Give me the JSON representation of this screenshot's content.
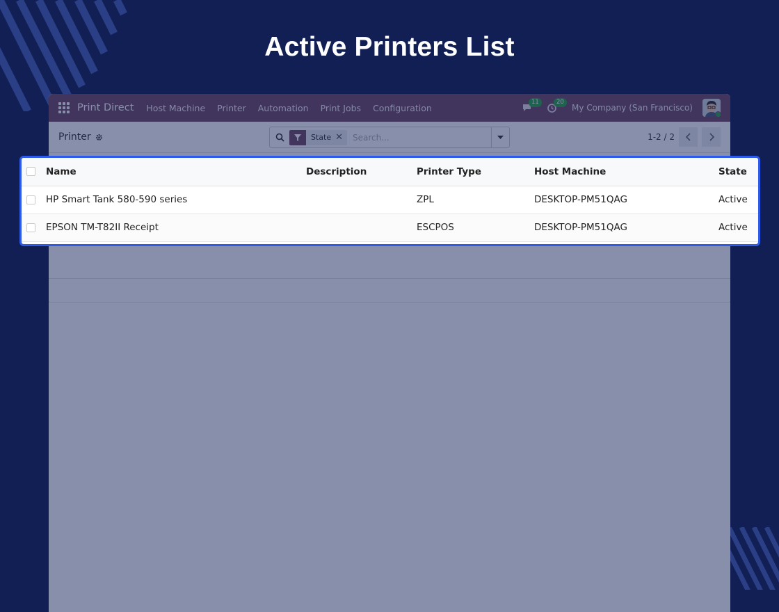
{
  "hero": {
    "title": "Active Printers List"
  },
  "colors": {
    "background": "#111f55",
    "navbar": "#714b67",
    "highlight": "#2f5bea",
    "badge": "#28a745"
  },
  "navbar": {
    "brand": "Print Direct",
    "menu": [
      "Host Machine",
      "Printer",
      "Automation",
      "Print Jobs",
      "Configuration"
    ],
    "messages_count": "11",
    "activities_count": "20",
    "company": "My Company (San Francisco)"
  },
  "control_panel": {
    "breadcrumb": "Printer",
    "facet_label": "State",
    "search_placeholder": "Search...",
    "pager": "1-2 / 2"
  },
  "table": {
    "columns": [
      "Name",
      "Description",
      "Printer Type",
      "Host Machine",
      "State"
    ],
    "rows": [
      {
        "name": "HP Smart Tank 580-590 series",
        "description": "",
        "printer_type": "ZPL",
        "host_machine": "DESKTOP-PM51QAG",
        "state": "Active"
      },
      {
        "name": "EPSON TM-T82II Receipt",
        "description": "",
        "printer_type": "ESCPOS",
        "host_machine": "DESKTOP-PM51QAG",
        "state": "Active"
      }
    ]
  },
  "icons": [
    "apps-grid-icon",
    "chat-icon",
    "clock-icon",
    "gear-icon",
    "search-icon",
    "filter-icon",
    "close-icon",
    "caret-down-icon",
    "chevron-left-icon",
    "chevron-right-icon",
    "checkbox-icon"
  ]
}
